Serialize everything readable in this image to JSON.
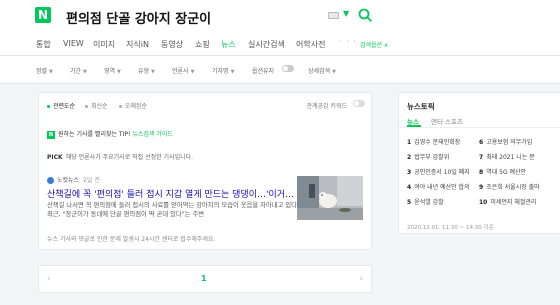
{
  "header": {
    "logo": "N",
    "query": "편의점 단골 강아지 장군이"
  },
  "gnb": {
    "tabs": [
      {
        "label": "통합",
        "active": false
      },
      {
        "label": "VIEW",
        "active": false
      },
      {
        "label": "이미지",
        "active": false
      },
      {
        "label": "지식iN",
        "active": false
      },
      {
        "label": "동영상",
        "active": false
      },
      {
        "label": "쇼핑",
        "active": false
      },
      {
        "label": "뉴스",
        "active": true
      },
      {
        "label": "실시간검색",
        "active": false
      },
      {
        "label": "어학사전",
        "active": false
      }
    ],
    "more": "· · ·",
    "search_option": "검색옵션 ∧"
  },
  "options": {
    "items": [
      "정렬",
      "기간",
      "영역",
      "유형",
      "언론사",
      "기자명"
    ],
    "highlight_label": "옵션유지",
    "detail_label": "상세검색"
  },
  "results": {
    "sort": [
      "관련도순",
      "최신순",
      "오래된순"
    ],
    "keyword_trend": "관계공감 키워드",
    "tip_badge": "N",
    "tip_text": "원하는 기사를 빨리찾는 TIP!",
    "tip_link": "뉴스검색 가이드",
    "pick_label": "PICK",
    "pick_text": "해당 언론사가 주요기사로 직접 선정한 기사입니다.",
    "news": {
      "press": "노컷뉴스",
      "date": "2일 전",
      "title": "산책길에 꼭 '편의점' 들러 접시 지갑 열게 만드는 댕댕이…'이거…",
      "desc": "산책길 나서면 꼭 편의점에 들러 접시의 사료를 얻어먹는 강아지의 모습이 웃음을 자아내고 있다. 최근, \"장군이가 동네에 단골 편의점이 딱 곧대 있다\"는 주변"
    },
    "notice": "뉴스 기사와 댓글로 인한 문제 발생시 24시간 센터로 접수해주세요."
  },
  "pagination": {
    "prev": "‹",
    "page": "1",
    "next": "›"
  },
  "side": {
    "title": "뉴스토픽",
    "tabs": [
      "뉴스",
      "엔터·스포츠"
    ],
    "topics": [
      {
        "rank": "1",
        "text": "김영수 문재인회장"
      },
      {
        "rank": "2",
        "text": "법무부 감찰위"
      },
      {
        "rank": "3",
        "text": "공인인증서 10일 폐지"
      },
      {
        "rank": "4",
        "text": "여야 내년 예산안 합의"
      },
      {
        "rank": "5",
        "text": "윤석열 감찰"
      },
      {
        "rank": "6",
        "text": "고용보험 의무가입"
      },
      {
        "rank": "7",
        "text": "최태 2021 니는 분"
      },
      {
        "rank": "8",
        "text": "역대 5G 예산안"
      },
      {
        "rank": "9",
        "text": "조은희 서울시장 출마"
      },
      {
        "rank": "10",
        "text": "미세먼지 체절관리"
      }
    ],
    "footer": "2020.12.01. 11:30 ~ 14:30 기준"
  },
  "colors": {
    "brand": "#03c75a",
    "title_link": "#1a0dab"
  }
}
